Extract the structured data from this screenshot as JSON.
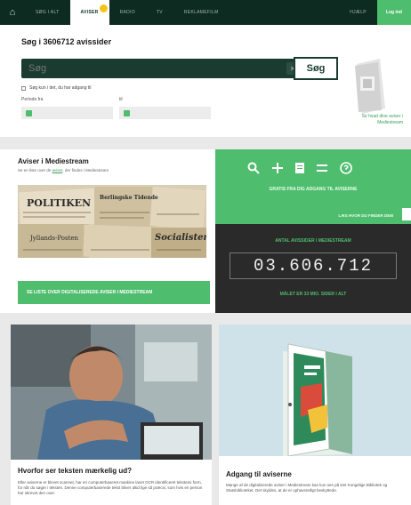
{
  "nav": {
    "items": [
      "Søg i alt",
      "Aviser",
      "Radio",
      "TV",
      "Reklamefilm"
    ],
    "active_index": 1,
    "right_item": "Hjælp",
    "login": "Log ind",
    "accent": "#4fbd6e",
    "dark": "#0e2b22"
  },
  "search": {
    "title": "Søg i 3606712 avissider",
    "placeholder": "Søg",
    "button": "Søg",
    "checkbox_label": "Søg kun i det, du har adgang til",
    "period_from_label": "Periode fra",
    "period_to_label": "til",
    "side_link": "Se hvad dine aviser i Mediestream"
  },
  "aviser": {
    "title": "Aviser i Mediestream",
    "sub_prefix": "Se en liste over de",
    "sub_link": "aviser",
    "sub_suffix": ", der findes i Mediestream",
    "collage_titles": [
      "POLITIKEN",
      "Berlingske Tidende",
      "Socialisten",
      "Jyllands-Posten"
    ],
    "button": "SE LISTE OVER DIGITALISEREDE AVISER I MEDIESTREAM"
  },
  "promo": {
    "text": "GRATIS FRA DIG ADGANG TIL AVISERNE",
    "link": "LÆS HVOR DU FINDER DEM"
  },
  "counter": {
    "label": "ANTAL AVISSIDER I MEDIESTREAM",
    "value": "03.606.712",
    "goal": "MÅLET ER 33 MIO. SIDER I ALT"
  },
  "article1": {
    "title": "Hvorfor ser teksten mærkelig ud?",
    "body": "Eller aviserne er blevet scannet, har en computerbaseret maskine lavet OCR identificeret tekstens form, for når du søger i teksten. Denne computerbaserede tekst bliver altid lige så præcis, som hvis en person har skrevet den over."
  },
  "article2": {
    "title": "Adgang til aviserne",
    "body": "Mange af de digitaliserede aviser i Mediestream kan kun ses på Det Kongelige Bibliotek og Statsbiblioteket. Det skyldes, at de er ophavsretligt beskyttede."
  }
}
